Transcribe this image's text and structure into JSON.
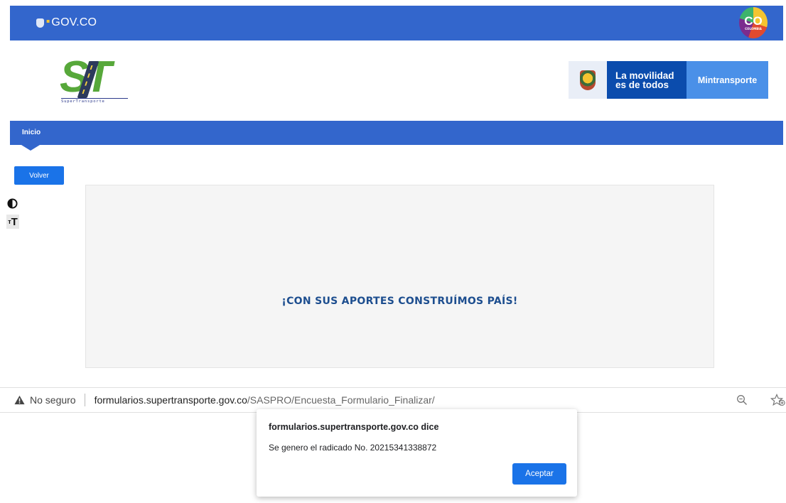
{
  "gov_bar": {
    "logo_text": "GOV.CO",
    "co_badge_text": "CO",
    "co_badge_subtext": "COLOMBIA",
    "background": "#3366cc"
  },
  "header": {
    "st_logo_letters": "ST",
    "st_logo_caption": "SuperTransporte",
    "mint_slogan_line1": "La movilidad",
    "mint_slogan_line2": "es de todos",
    "mint_name": "Mintransporte"
  },
  "nav": {
    "items": [
      {
        "label": "Inicio"
      }
    ]
  },
  "actions": {
    "back_label": "Volver"
  },
  "accessibility": {
    "contrast_icon": "contrast-icon",
    "text_size_icon": "text-size-icon"
  },
  "main": {
    "slogan": "¡CON SUS APORTES CONSTRUÍMOS PAÍS!"
  },
  "browser": {
    "security_label": "No seguro",
    "url_host": "formularios.supertransporte.gov.co",
    "url_path": "/SASPRO/Encuesta_Formulario_Finalizar/"
  },
  "dialog": {
    "title": "formularios.supertransporte.gov.co dice",
    "message": "Se genero el radicado No. 20215341338872",
    "ok_label": "Aceptar"
  },
  "colors": {
    "primary_blue": "#3366cc",
    "button_blue": "#1a73e8",
    "slogan_blue": "#1d4e8f",
    "logo_green": "#57a83a"
  }
}
